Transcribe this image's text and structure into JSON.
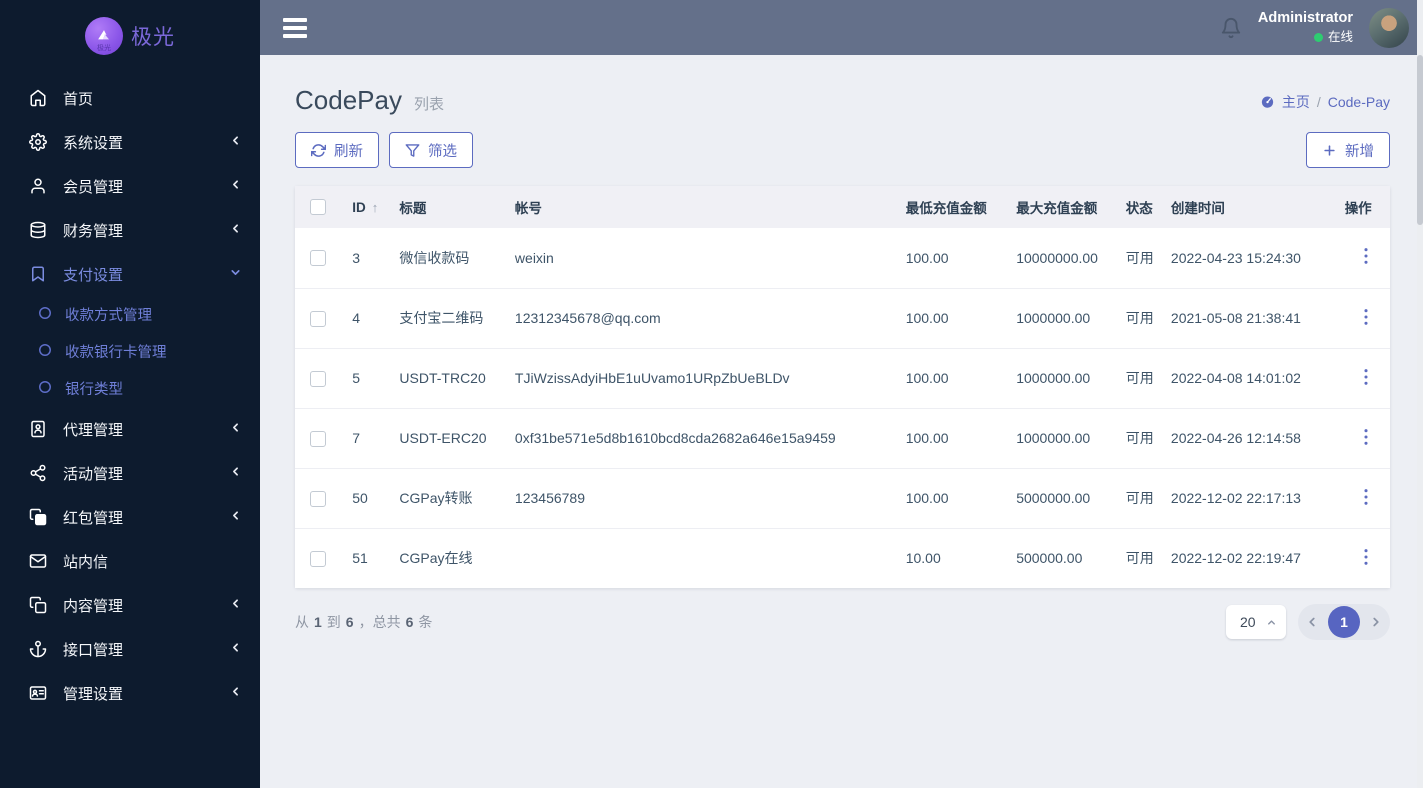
{
  "colors": {
    "accent": "#5c6bc0",
    "sidebar_bg": "#0d1b2e",
    "topbar_bg": "#64708a",
    "online": "#2ecc71",
    "purple": "#7b8ce0"
  },
  "brand": {
    "name": "极光"
  },
  "sidebar": {
    "items": [
      {
        "label": "首页",
        "icon": "home-icon"
      },
      {
        "label": "系统设置",
        "icon": "gear-icon",
        "chevron": "left"
      },
      {
        "label": "会员管理",
        "icon": "user-icon",
        "chevron": "left"
      },
      {
        "label": "财务管理",
        "icon": "database-icon",
        "chevron": "left"
      },
      {
        "label": "支付设置",
        "icon": "bookmark-icon",
        "chevron": "down",
        "active": true,
        "children": [
          "收款方式管理",
          "收款银行卡管理",
          "银行类型"
        ]
      },
      {
        "label": "代理管理",
        "icon": "address-book-icon",
        "chevron": "left"
      },
      {
        "label": "活动管理",
        "icon": "share-icon",
        "chevron": "left"
      },
      {
        "label": "红包管理",
        "icon": "red-packet-icon",
        "chevron": "left"
      },
      {
        "label": "站内信",
        "icon": "envelope-icon"
      },
      {
        "label": "内容管理",
        "icon": "copy-icon",
        "chevron": "left"
      },
      {
        "label": "接口管理",
        "icon": "anchor-icon",
        "chevron": "left"
      },
      {
        "label": "管理设置",
        "icon": "id-card-icon",
        "chevron": "left"
      }
    ]
  },
  "topbar": {
    "user": "Administrator",
    "status": "在线"
  },
  "page": {
    "title": "CodePay",
    "subtitle": "列表",
    "breadcrumb_home": "主页",
    "breadcrumb_sep": "/",
    "breadcrumb_current": "Code-Pay"
  },
  "toolbar": {
    "refresh": "刷新",
    "filter": "筛选",
    "add": "新增"
  },
  "table": {
    "headers": {
      "id": "ID",
      "sort": "↑",
      "title": "标题",
      "account": "帐号",
      "min": "最低充值金额",
      "max": "最大充值金额",
      "status": "状态",
      "created": "创建时间",
      "action": "操作"
    },
    "rows": [
      {
        "id": "3",
        "title": "微信收款码",
        "account": "weixin",
        "min": "100.00",
        "max": "10000000.00",
        "status": "可用",
        "created": "2022-04-23 15:24:30"
      },
      {
        "id": "4",
        "title": "支付宝二维码",
        "account": "12312345678@qq.com",
        "min": "100.00",
        "max": "1000000.00",
        "status": "可用",
        "created": "2021-05-08 21:38:41"
      },
      {
        "id": "5",
        "title": "USDT-TRC20",
        "account": "TJiWzissAdyiHbE1uUvamo1URpZbUeBLDv",
        "min": "100.00",
        "max": "1000000.00",
        "status": "可用",
        "created": "2022-04-08 14:01:02"
      },
      {
        "id": "7",
        "title": "USDT-ERC20",
        "account": "0xf31be571e5d8b1610bcd8cda2682a646e15a9459",
        "min": "100.00",
        "max": "1000000.00",
        "status": "可用",
        "created": "2022-04-26 12:14:58"
      },
      {
        "id": "50",
        "title": "CGPay转账",
        "account": "123456789",
        "min": "100.00",
        "max": "5000000.00",
        "status": "可用",
        "created": "2022-12-02 22:17:13"
      },
      {
        "id": "51",
        "title": "CGPay在线",
        "account": "",
        "min": "10.00",
        "max": "500000.00",
        "status": "可用",
        "created": "2022-12-02 22:19:47"
      }
    ]
  },
  "footer": {
    "t_from": "从",
    "n_from": "1",
    "t_to": "到",
    "n_to": "6",
    "t_total": "，总共",
    "n_total": "6",
    "t_unit": "条",
    "page_size": "20",
    "current_page": "1"
  }
}
